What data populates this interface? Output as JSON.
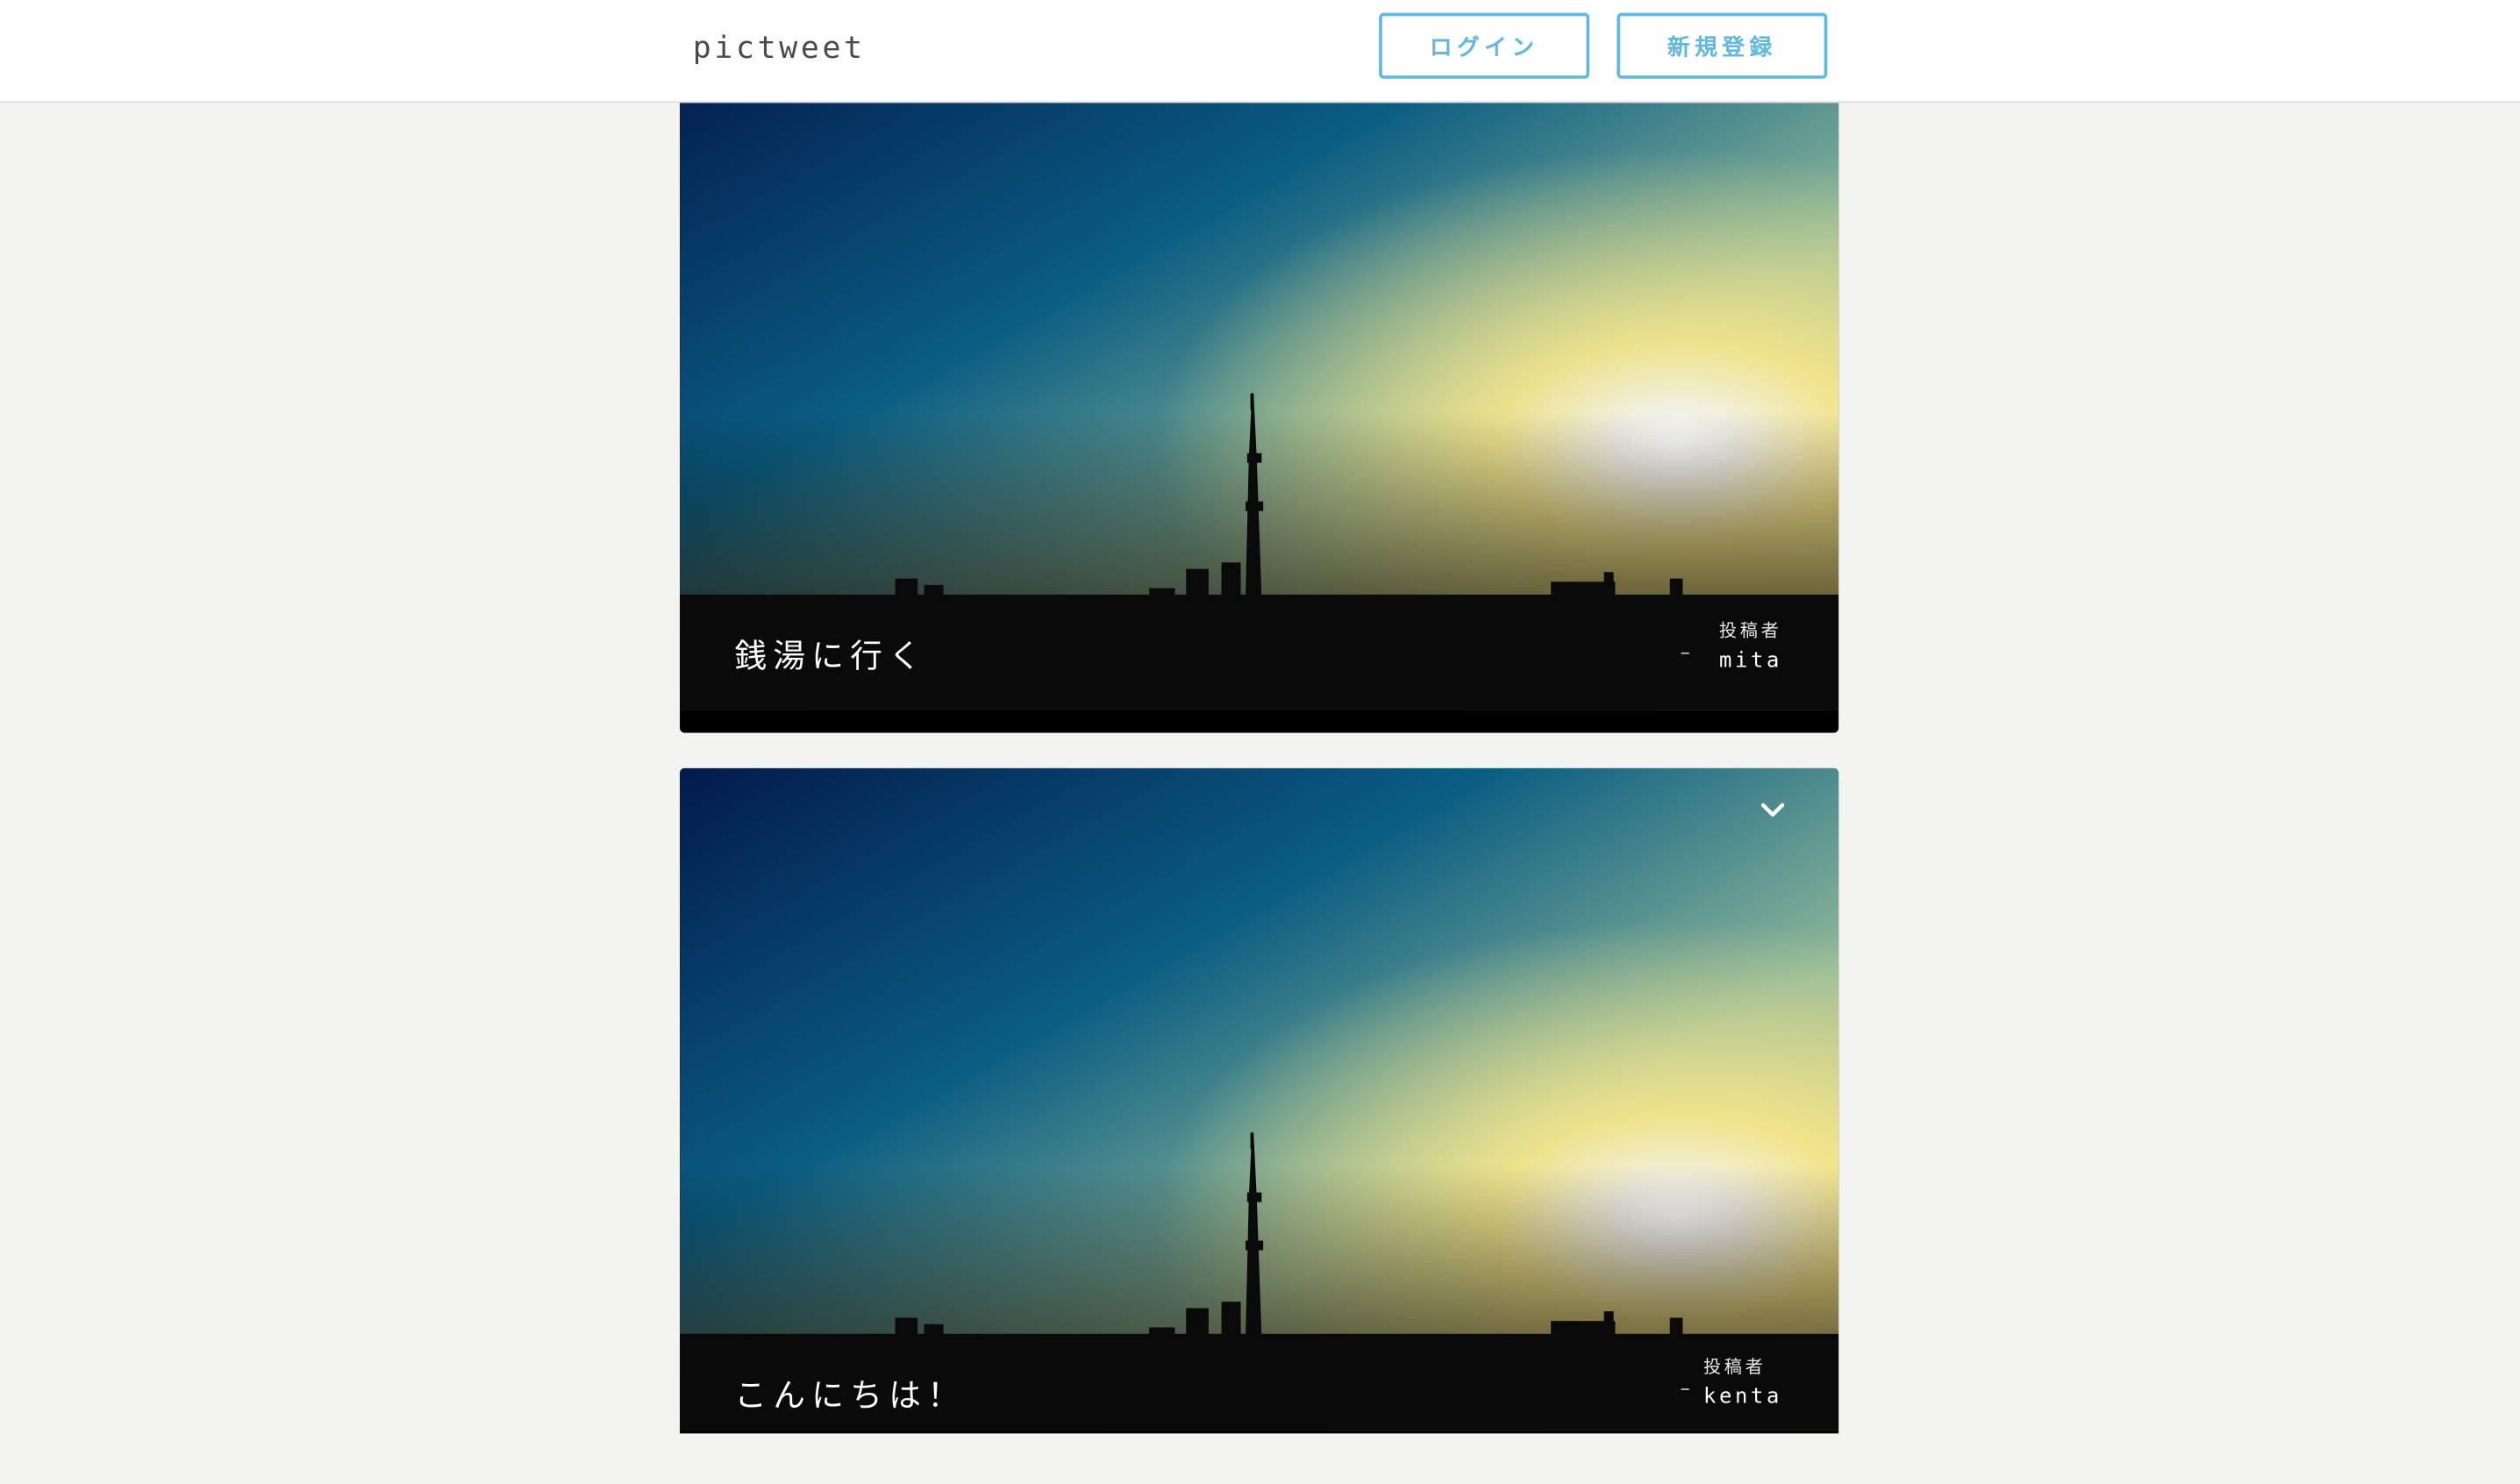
{
  "header": {
    "logo": "pictweet",
    "login_label": "ログイン",
    "signup_label": "新規登録",
    "accent_color": "#62b8dd"
  },
  "posts": [
    {
      "text": "銭湯に行く",
      "author_caption": "投稿者",
      "author": "mita"
    },
    {
      "text": "こんにちは！",
      "author_caption": "投稿者",
      "author": "kenta"
    }
  ],
  "icons": {
    "post_menu": "chevron-down-icon"
  }
}
